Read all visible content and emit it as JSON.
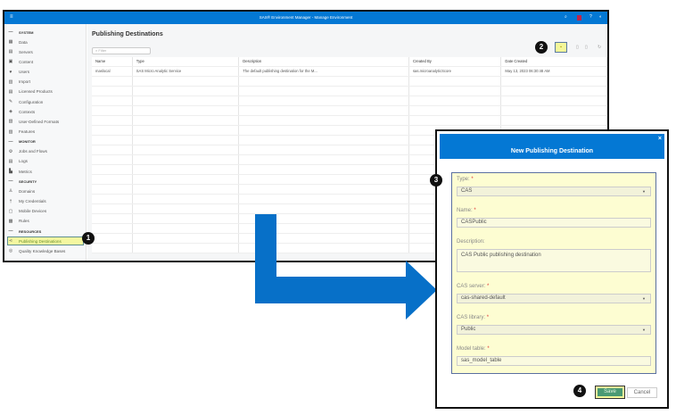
{
  "app": {
    "title": "SAS® Environment Manager - Manage Environment"
  },
  "sidebar": {
    "items": [
      {
        "label": "SYSTEM",
        "section": true,
        "icon": "dash"
      },
      {
        "label": "Data",
        "icon": "grid-icon"
      },
      {
        "label": "Servers",
        "icon": "server-icon"
      },
      {
        "label": "Content",
        "icon": "content-icon"
      },
      {
        "label": "Users",
        "icon": "users-icon"
      },
      {
        "label": "Import",
        "icon": "import-icon"
      },
      {
        "label": "Licensed Products",
        "icon": "license-icon"
      },
      {
        "label": "Configuration",
        "icon": "wrench-icon"
      },
      {
        "label": "Contexts",
        "icon": "contexts-icon"
      },
      {
        "label": "User-Defined Formats",
        "icon": "formats-icon"
      },
      {
        "label": "Features",
        "icon": "features-icon"
      },
      {
        "label": "MONITOR",
        "section": true,
        "icon": "dash"
      },
      {
        "label": "Jobs and Flows",
        "icon": "gear-icon"
      },
      {
        "label": "Logs",
        "icon": "logs-icon"
      },
      {
        "label": "Metrics",
        "icon": "metrics-icon"
      },
      {
        "label": "SECURITY",
        "section": true,
        "icon": "dash"
      },
      {
        "label": "Domains",
        "icon": "domains-icon"
      },
      {
        "label": "My Credentials",
        "icon": "key-icon"
      },
      {
        "label": "Mobile Devices",
        "icon": "mobile-icon"
      },
      {
        "label": "Rules",
        "icon": "rules-icon"
      },
      {
        "label": "RESOURCES",
        "section": true,
        "icon": "dash"
      },
      {
        "label": "Publishing Destinations",
        "icon": "share-icon",
        "active": true
      },
      {
        "label": "Quality Knowledge Bases",
        "icon": "qkb-icon"
      }
    ]
  },
  "main": {
    "title": "Publishing Destinations",
    "filter_placeholder": "Filter",
    "columns": [
      "Name",
      "Type",
      "Description",
      "Created By",
      "Date Created"
    ],
    "rows": [
      [
        "maslocal",
        "SAS Micro Analytic Service",
        "The default publishing destination for the M...",
        "sas.microanalyticScore",
        "May 13, 2023 06:30:48 AM"
      ]
    ]
  },
  "callouts": [
    "1",
    "2",
    "3",
    "4"
  ],
  "dialog": {
    "title": "New Publishing Destination",
    "close": "×",
    "fields": [
      {
        "label": "Type:",
        "required": "*",
        "value": "CAS",
        "kind": "select"
      },
      {
        "label": "Name:",
        "required": "*",
        "value": "CASPublic",
        "kind": "text"
      },
      {
        "label": "Description:",
        "required": "",
        "value": "CAS Public publishing destination",
        "kind": "textarea"
      },
      {
        "label": "CAS server:",
        "required": "*",
        "value": "cas-shared-default",
        "kind": "select"
      },
      {
        "label": "CAS library:",
        "required": "*",
        "value": "Public",
        "kind": "select"
      },
      {
        "label": "Model table:",
        "required": "*",
        "value": "sas_model_table",
        "kind": "text"
      }
    ],
    "save": "Save",
    "cancel": "Cancel"
  },
  "colors": {
    "brand": "#0478d4",
    "highlight": "#f4f79a",
    "save": "#4a9a73"
  }
}
